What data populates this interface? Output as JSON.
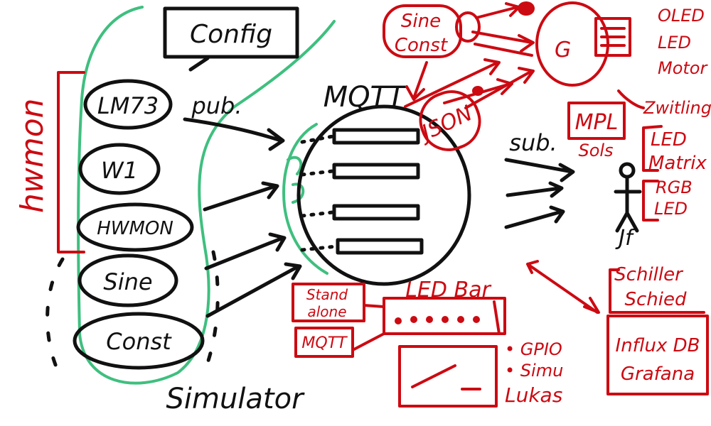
{
  "colors": {
    "ink": "#111111",
    "red": "#cc0a12",
    "green": "#3fbf7f",
    "background": "#ffffff"
  },
  "black": {
    "config": "Config",
    "lm73": "LM73",
    "w1": "W1",
    "hwmon_src": "HWMON",
    "sine": "Sine",
    "const": "Const",
    "pub": "pub.",
    "mqtt": "MQTT",
    "sub": "sub.",
    "simulator": "Simulator"
  },
  "red": {
    "hwmon_bracket": "hwmon",
    "sine": "Sine",
    "const": "Const",
    "json": "JSON",
    "oled": "OLED",
    "leo": "LED",
    "motor": "Motor",
    "zwitling": "Zwitling",
    "mpl": "MPL",
    "sols": "Sols",
    "led_matrix_1": "LED",
    "led_matrix_2": "Matrix",
    "rgb_led_1": "RGB",
    "rgb_led_2": "LED",
    "jf": "Jf",
    "schiller_1": "Schiller",
    "schiller_2": "Schied",
    "influx": "Influx DB",
    "grafana": "Grafana",
    "stand_alone_1": "Stand",
    "stand_alone_2": "alone",
    "mqtt_small": "MQTT",
    "led_bar": "LED Bar",
    "gpio": "• GPIO",
    "simu": "• Simu",
    "lukas": "Lukas"
  }
}
